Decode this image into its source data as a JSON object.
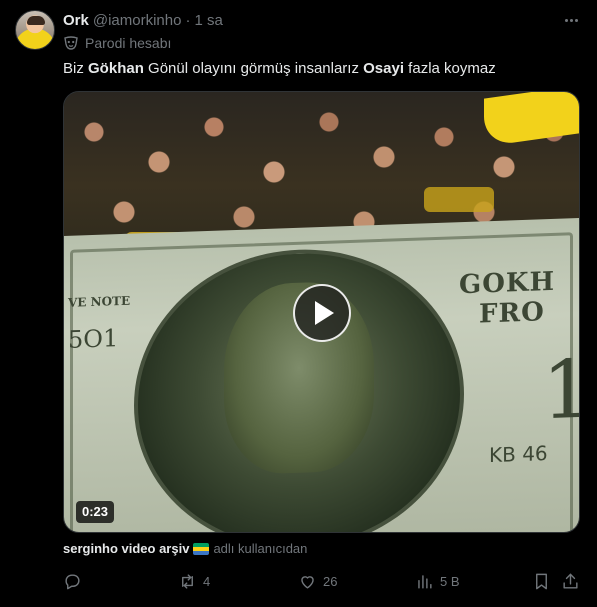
{
  "tweet": {
    "author_name": "Ork",
    "handle": "@iamorkinho",
    "separator": "·",
    "time": "1 sa",
    "parody_label": "Parodi hesabı",
    "text_parts": {
      "p1": "Biz ",
      "b1": "Gökhan",
      "p2": " Gönül olayını görmüş insanlarız ",
      "b2": "Osayi",
      "p3": " fazla koymaz"
    }
  },
  "media": {
    "duration": "0:23",
    "note_texts": {
      "gok": "GOKH",
      "fro": "FRO",
      "ve_note": "VE NOTE",
      "num": "5O1",
      "big_one": "1",
      "kb": "KB 46"
    }
  },
  "source": {
    "name": "serginho video arşiv",
    "flag": "gabon-flag",
    "suffix": "adlı kullanıcıdan"
  },
  "actions": {
    "replies": "",
    "retweets": "4",
    "likes": "26",
    "views": "5 B"
  },
  "colors": {
    "background": "#000000",
    "text_primary": "#e7e9ea",
    "text_secondary": "#71767b",
    "border": "#2f3336"
  }
}
